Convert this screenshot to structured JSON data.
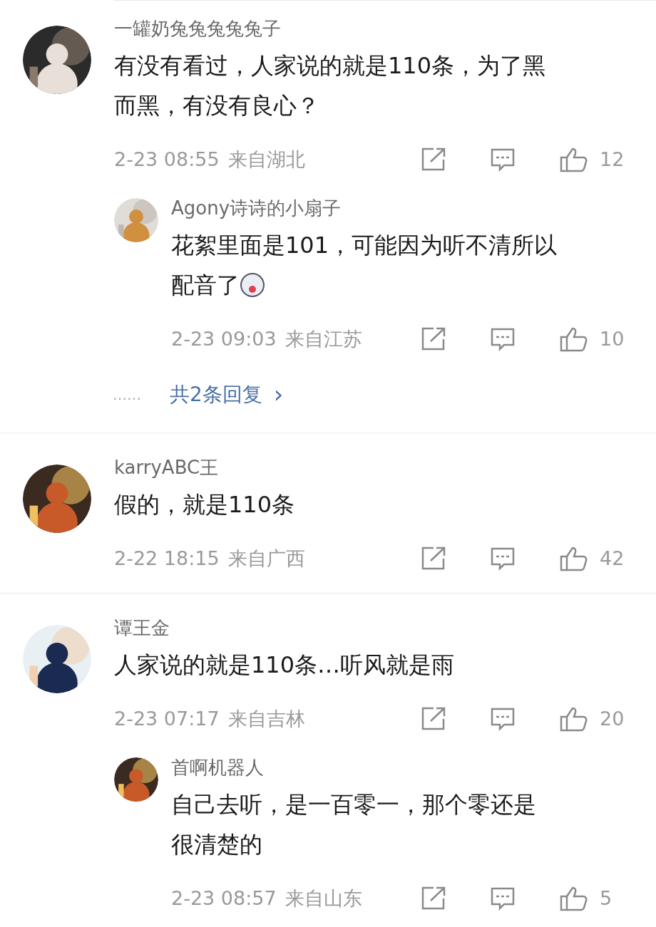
{
  "comments": [
    {
      "username": "一罐奶兔兔兔兔兔子",
      "lines": [
        "有没有看过，人家说的就是110条，为了黑",
        "而黑，有没有良心？"
      ],
      "date": "2-23 08:55",
      "location": "来自湖北",
      "likes": "12",
      "replies": [
        {
          "username": "Agony诗诗的小扇子",
          "lines": [
            "花絮里面是101，可能因为听不清所以",
            "配音了"
          ],
          "emoji": true,
          "date": "2-23 09:03",
          "location": "来自江苏",
          "likes": "10"
        }
      ],
      "more": {
        "dots": "……",
        "label": "共2条回复",
        "chevron": "›"
      }
    },
    {
      "username": "karryABC王",
      "lines": [
        "假的，就是110条"
      ],
      "date": "2-22 18:15",
      "location": "来自广西",
      "likes": "42"
    },
    {
      "username": "谭王金",
      "lines": [
        "人家说的就是110条…听风就是雨"
      ],
      "date": "2-23 07:17",
      "location": "来自吉林",
      "likes": "20",
      "replies": [
        {
          "username": "首啊机器人",
          "lines": [
            "自己去听，是一百零一，那个零还是",
            "很清楚的"
          ],
          "date": "2-23 08:57",
          "location": "来自山东",
          "likes": "5"
        }
      ]
    }
  ]
}
